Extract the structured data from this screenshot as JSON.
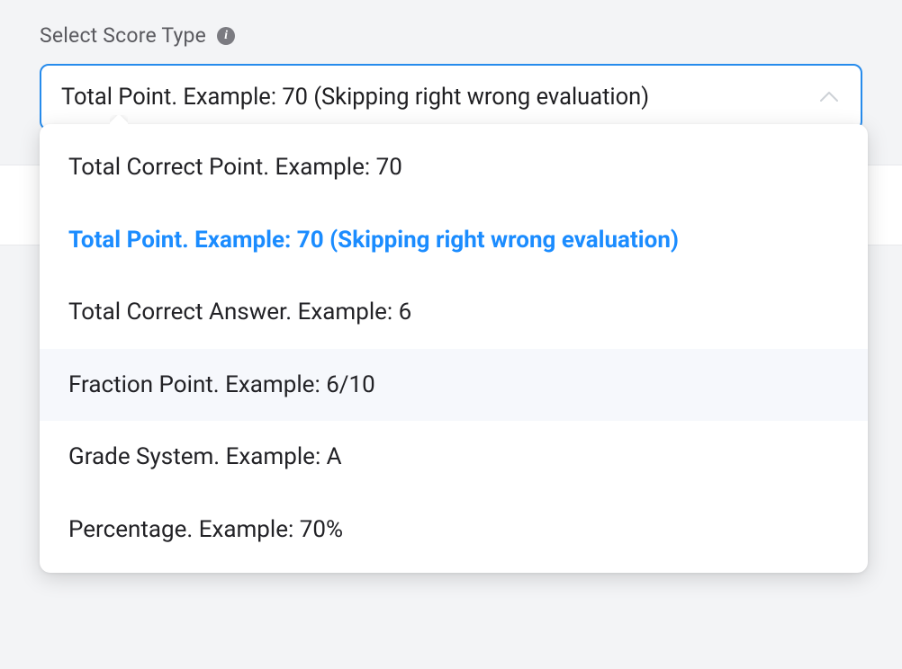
{
  "form": {
    "label": "Select Score Type"
  },
  "select": {
    "value": "Total Point. Example: 70 (Skipping right wrong evaluation)"
  },
  "options": [
    {
      "label": "Total Correct Point. Example: 70",
      "selected": false,
      "hover": false
    },
    {
      "label": "Total Point. Example: 70 (Skipping right wrong evaluation)",
      "selected": true,
      "hover": false
    },
    {
      "label": "Total Correct Answer. Example: 6",
      "selected": false,
      "hover": false
    },
    {
      "label": "Fraction Point. Example: 6/10",
      "selected": false,
      "hover": true
    },
    {
      "label": "Grade System. Example: A",
      "selected": false,
      "hover": false
    },
    {
      "label": "Percentage. Example: 70%",
      "selected": false,
      "hover": false
    }
  ]
}
